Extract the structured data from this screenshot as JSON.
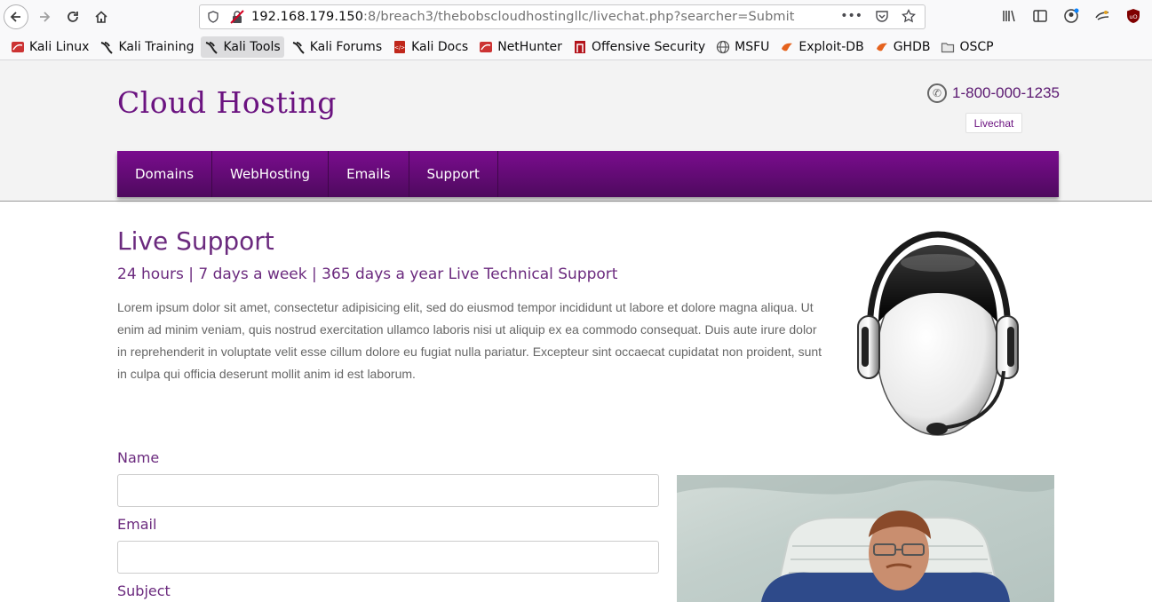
{
  "browser": {
    "url_host": "192.168.179.150",
    "url_rest": ":8/breach3/thebobscloudhostingllc/livechat.php?searcher=Submit",
    "icons": {
      "back": "back-arrow-icon",
      "forward": "forward-arrow-icon",
      "reload": "reload-icon",
      "home": "home-icon",
      "url_actions": [
        "more-icon",
        "pocket-icon",
        "bookmark-star-icon"
      ],
      "right_tools": [
        "library-icon",
        "sidebar-icon",
        "account-icon",
        "extension-icon",
        "ublock-icon"
      ]
    }
  },
  "bookmarks": [
    {
      "label": "Kali Linux",
      "icon": "kali-icon",
      "color": "#c33"
    },
    {
      "label": "Kali Training",
      "icon": "kali-dragon-icon",
      "color": "#222"
    },
    {
      "label": "Kali Tools",
      "icon": "kali-dragon-icon",
      "color": "#222"
    },
    {
      "label": "Kali Forums",
      "icon": "kali-dragon-icon",
      "color": "#222"
    },
    {
      "label": "Kali Docs",
      "icon": "docs-icon",
      "color": "#c0271b"
    },
    {
      "label": "NetHunter",
      "icon": "kali-icon",
      "color": "#c33"
    },
    {
      "label": "Offensive Security",
      "icon": "offsec-icon",
      "color": "#b3131b"
    },
    {
      "label": "MSFU",
      "icon": "globe-icon",
      "color": "#555"
    },
    {
      "label": "Exploit-DB",
      "icon": "exploitdb-icon",
      "color": "#e5621d"
    },
    {
      "label": "GHDB",
      "icon": "exploitdb-icon",
      "color": "#e5621d"
    },
    {
      "label": "OSCP",
      "icon": "folder-icon",
      "color": "#888"
    }
  ],
  "site": {
    "logo": "Cloud Hosting",
    "phone": "1-800-000-1235",
    "livechat": "Livechat",
    "nav": [
      "Domains",
      "WebHosting",
      "Emails",
      "Support"
    ],
    "title": "Live Support",
    "subtitle": "24 hours | 7 days a week | 365 days a year Live Technical Support",
    "body": "Lorem ipsum dolor sit amet, consectetur adipisicing elit, sed do eiusmod tempor incididunt ut labore et dolore magna aliqua. Ut enim ad minim veniam, quis nostrud exercitation ullamco laboris nisi ut aliquip ex ea commodo consequat. Duis aute irure dolor in reprehenderit in voluptate velit esse cillum dolore eu fugiat nulla pariatur. Excepteur sint occaecat cupidatat non proident, sunt in culpa qui officia deserunt mollit anim id est laborum.",
    "form": {
      "name_label": "Name",
      "email_label": "Email",
      "subject_label": "Subject"
    }
  },
  "colors": {
    "brand_purple": "#6b1380",
    "nav_top": "#7a0c8e",
    "nav_bottom": "#4e0a5e"
  }
}
